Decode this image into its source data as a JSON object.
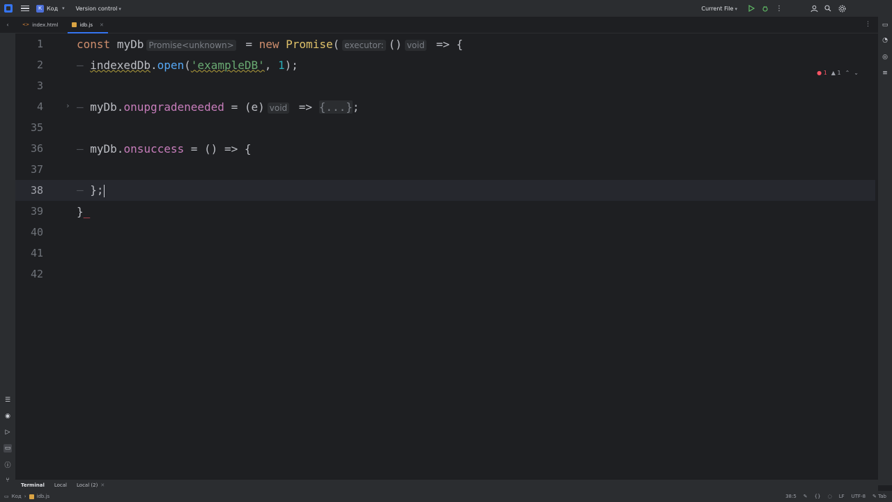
{
  "titlebar": {
    "project_badge": "К",
    "project_name": "Код",
    "version_control": "Version control",
    "run_config": "Current File"
  },
  "tabs": [
    {
      "label": "index.html"
    },
    {
      "label": "idb.js"
    }
  ],
  "editor": {
    "line_numbers": [
      "1",
      "2",
      "3",
      "4",
      "35",
      "36",
      "37",
      "38",
      "39",
      "40",
      "41",
      "42"
    ],
    "line1": {
      "kw_const": "const",
      "var": "myDb",
      "hint_type": "Promise<unknown>",
      "eq": "=",
      "kw_new": "new",
      "cls": "Promise",
      "paren": "(",
      "hint_executor": "executor:",
      "arrow_parens": "()",
      "hint_void": "void",
      "arrow": "=>",
      "brace": "{"
    },
    "line2": {
      "obj": "indexedDb",
      "dot": ".",
      "fn": "open",
      "open": "(",
      "str": "'exampleDB'",
      "comma": ", ",
      "num": "1",
      "close": ");"
    },
    "line4": {
      "obj": "myDb",
      "dot": ".",
      "prop": "onupgradeneeded",
      "eq": " = ",
      "params": "(e)",
      "hint_void": "void",
      "arrow": " => ",
      "folded": "{...}",
      "semi": ";"
    },
    "line36": {
      "obj": "myDb",
      "dot": ".",
      "prop": "onsuccess",
      "eq": " = ",
      "params": "()",
      "arrow": " => ",
      "brace": "{"
    },
    "line38": {
      "close": "};"
    },
    "line39": {
      "close": "}"
    },
    "inspection": {
      "errors": "1",
      "warnings": "1"
    }
  },
  "bottom": {
    "terminal_label": "Terminal",
    "tabs": [
      "Local",
      "Local (2)"
    ]
  },
  "statusbar": {
    "breadcrumb_project": "Код",
    "breadcrumb_file": "idb.js",
    "position": "38:5",
    "line_sep": "LF",
    "encoding": "UTF-8",
    "indent": "Tab"
  }
}
